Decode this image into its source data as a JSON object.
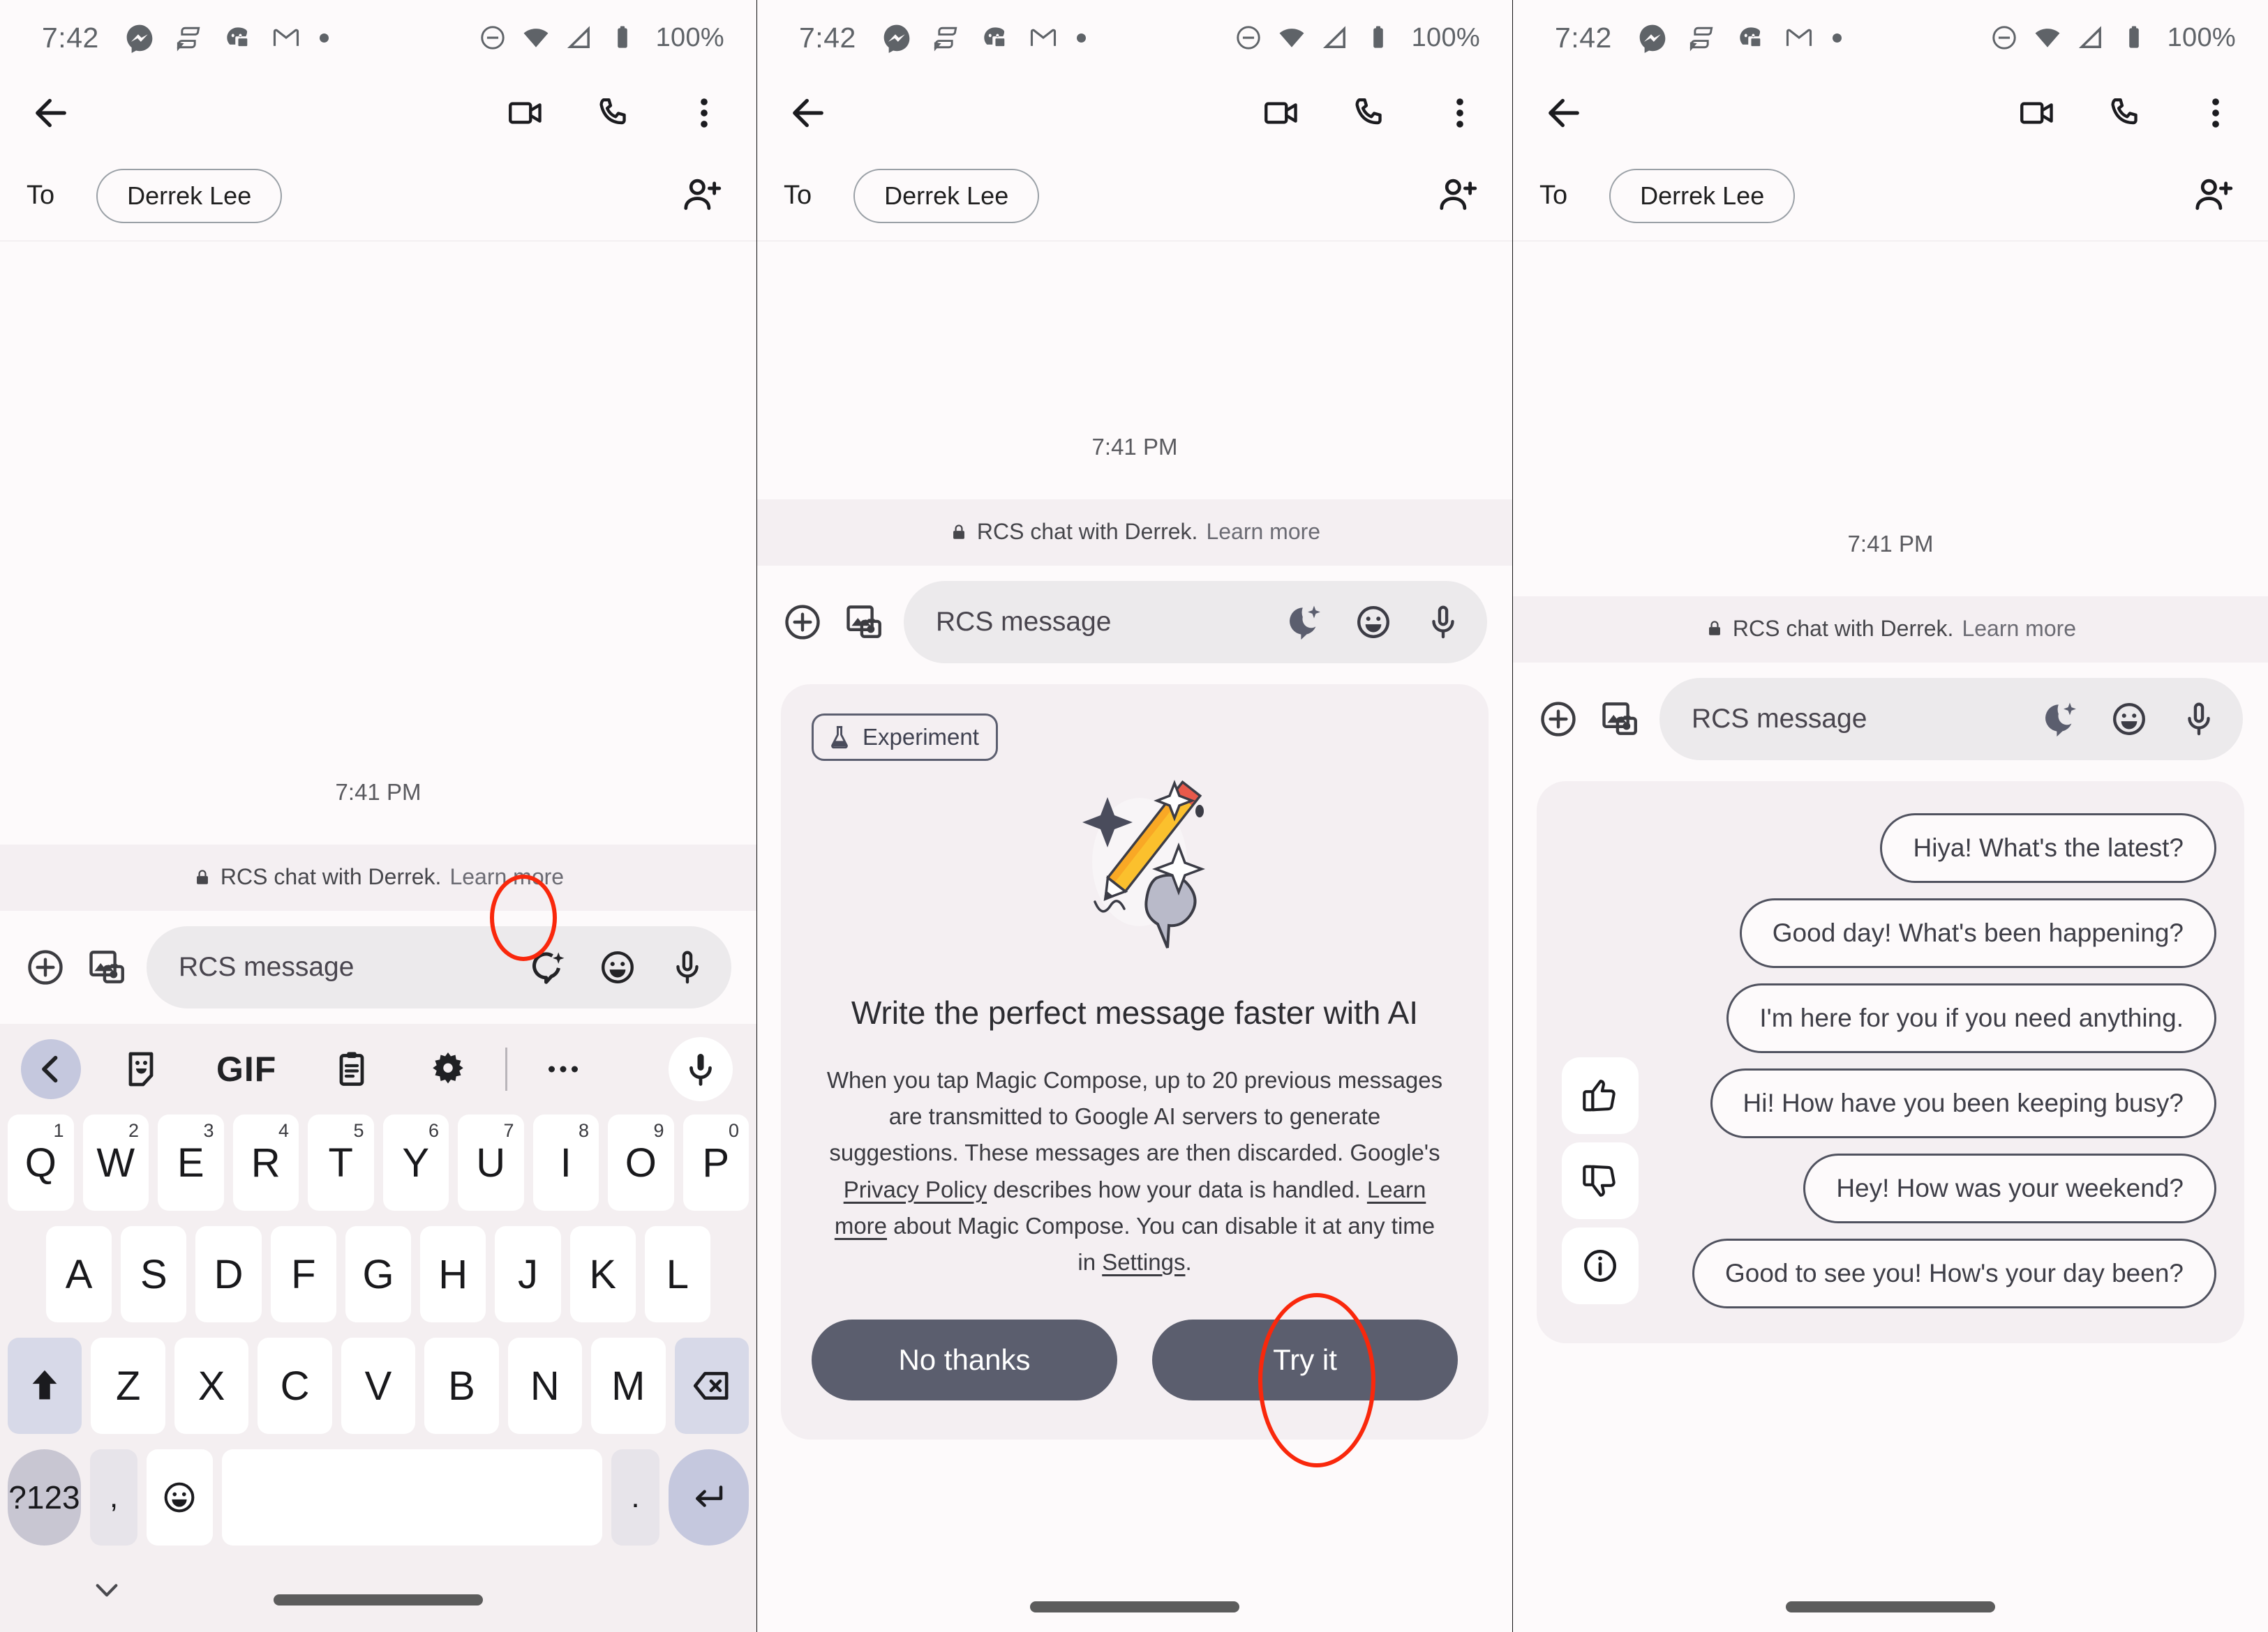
{
  "status_bar": {
    "time": "7:42",
    "battery": "100%",
    "left_icons": [
      "messenger-icon",
      "signal-app-icon",
      "discord-icon",
      "gmail-icon",
      "notification-dot-icon"
    ],
    "right_icons": [
      "dnd-icon",
      "wifi-icon",
      "cellular-icon",
      "battery-icon"
    ]
  },
  "app_bar": {
    "back_icon": "back-arrow-icon",
    "actions": [
      "video-call-icon",
      "phone-call-icon",
      "overflow-menu-icon"
    ]
  },
  "recipient_row": {
    "to_label": "To",
    "contact_chip": "Derrek Lee",
    "add_people_icon": "add-person-icon"
  },
  "thread": {
    "timestamp": "7:41 PM",
    "rcs_notice": "RCS chat with Derrek.",
    "rcs_notice_link": "Learn more",
    "lock_icon": "lock-icon"
  },
  "compose_bar": {
    "plus_icon": "add-attachment-icon",
    "gallery_icon": "gallery-camera-icon",
    "placeholder": "RCS message",
    "magic_compose_icon": "magic-compose-icon",
    "emoji_icon": "emoji-icon",
    "mic_icon": "microphone-icon"
  },
  "keyboard": {
    "toolbar": {
      "back_icon": "chevron-left-icon",
      "sticker_icon": "sticker-icon",
      "gif_label": "GIF",
      "clipboard_icon": "clipboard-icon",
      "settings_icon": "gear-icon",
      "more_icon": "more-horizontal-icon",
      "mic_icon": "microphone-icon"
    },
    "row1": [
      {
        "key": "Q",
        "num": "1"
      },
      {
        "key": "W",
        "num": "2"
      },
      {
        "key": "E",
        "num": "3"
      },
      {
        "key": "R",
        "num": "4"
      },
      {
        "key": "T",
        "num": "5"
      },
      {
        "key": "Y",
        "num": "6"
      },
      {
        "key": "U",
        "num": "7"
      },
      {
        "key": "I",
        "num": "8"
      },
      {
        "key": "O",
        "num": "9"
      },
      {
        "key": "P",
        "num": "0"
      }
    ],
    "row2": [
      "A",
      "S",
      "D",
      "F",
      "G",
      "H",
      "J",
      "K",
      "L"
    ],
    "row3": [
      "Z",
      "X",
      "C",
      "V",
      "B",
      "N",
      "M"
    ],
    "shift_icon": "shift-icon",
    "backspace_icon": "backspace-icon",
    "symbols_label": "?123",
    "comma_label": ",",
    "emoji_icon": "emoji-icon",
    "period_label": ".",
    "enter_icon": "enter-icon",
    "hide_keyboard_icon": "chevron-down-icon"
  },
  "magic_compose_dialog": {
    "experiment_badge": "Experiment",
    "flask_icon": "flask-icon",
    "illustration": "pencil-sparkle-bubble-illustration",
    "title": "Write the perfect message faster with AI",
    "body_part1": "When you tap Magic Compose, up to 20 previous messages are transmitted to Google AI servers to generate suggestions. These messages are then discarded. Google's ",
    "link_privacy": "Privacy Policy",
    "body_part2": " describes how your data is handled. ",
    "link_learn_more": "Learn more",
    "body_part3": " about Magic Compose. You can disable it at any time in ",
    "link_settings": "Settings",
    "body_part4": ".",
    "decline_label": "No thanks",
    "accept_label": "Try it"
  },
  "suggestions_panel": {
    "rail": [
      "thumbs-up-icon",
      "thumbs-down-icon",
      "info-icon"
    ],
    "chips": [
      "Hiya! What's the latest?",
      "Good day! What's been happening?",
      "I'm here for you if you need anything.",
      "Hi! How have you been keeping busy?",
      "Hey! How was your weekend?",
      "Good to see you! How's your day been?"
    ]
  },
  "highlights": [
    {
      "target": "magic-compose-icon-panel1",
      "color": "#f9280c"
    },
    {
      "target": "try-it-button",
      "color": "#f9280c"
    }
  ],
  "colors": {
    "screen_bg": "#fdfafb",
    "keyboard_bg": "#f4eff1",
    "card_bg": "#f4eff2",
    "button_fill": "#5b5e6e",
    "chip_border": "#50525f",
    "highlight": "#f9280c"
  }
}
